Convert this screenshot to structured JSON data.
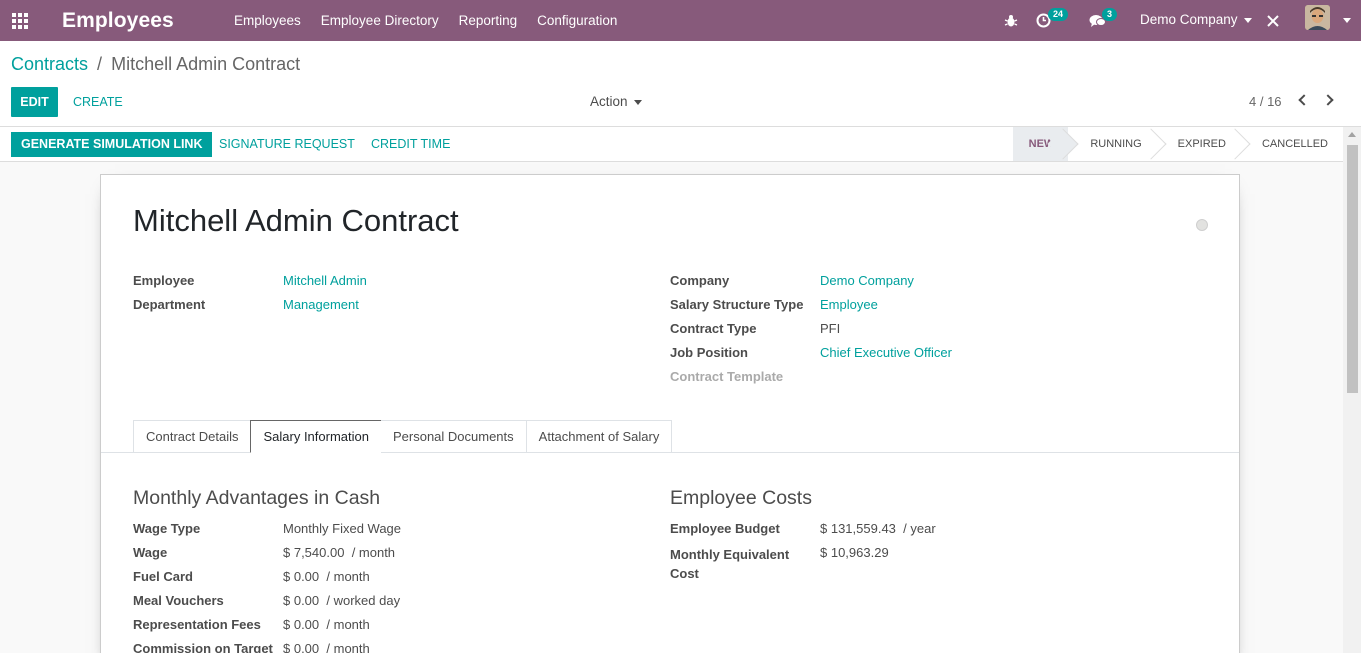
{
  "navbar": {
    "brand": "Employees",
    "menu": [
      "Employees",
      "Employee Directory",
      "Reporting",
      "Configuration"
    ],
    "activity_count": "24",
    "message_count": "3",
    "company": "Demo Company"
  },
  "breadcrumb": {
    "parent": "Contracts",
    "separator": "/",
    "current": "Mitchell Admin Contract"
  },
  "buttons": {
    "edit": "EDIT",
    "create": "CREATE",
    "action": "Action",
    "pager": "4 / 16"
  },
  "statusbar": {
    "generate": "GENERATE SIMULATION LINK",
    "signature": "SIGNATURE REQUEST",
    "credit_time": "CREDIT TIME",
    "stages": [
      "NEW",
      "RUNNING",
      "EXPIRED",
      "CANCELLED"
    ],
    "current_stage": "NEW"
  },
  "form": {
    "title": "Mitchell Admin Contract",
    "left": [
      {
        "label": "Employee",
        "value": "Mitchell Admin"
      },
      {
        "label": "Department",
        "value": "Management"
      }
    ],
    "right": [
      {
        "label": "Company",
        "value": "Demo Company"
      },
      {
        "label": "Salary Structure Type",
        "value": "Employee"
      },
      {
        "label": "Contract Type",
        "value": "PFI"
      },
      {
        "label": "Job Position",
        "value": "Chief Executive Officer"
      },
      {
        "label": "Contract Template",
        "value": ""
      }
    ],
    "tabs": [
      "Contract Details",
      "Salary Information",
      "Personal Documents",
      "Attachment of Salary"
    ],
    "active_tab": "Salary Information"
  },
  "salary": {
    "left_title": "Monthly Advantages in Cash",
    "left_rows": [
      {
        "label": "Wage Type",
        "value": "Monthly Fixed Wage",
        "unit": ""
      },
      {
        "label": "Wage",
        "value": "$ 7,540.00",
        "unit": "/ month"
      },
      {
        "label": "Fuel Card",
        "value": "$ 0.00",
        "unit": "/ month"
      },
      {
        "label": "Meal Vouchers",
        "value": "$ 0.00",
        "unit": "/ worked day"
      },
      {
        "label": "Representation Fees",
        "value": "$ 0.00",
        "unit": "/ month"
      },
      {
        "label": "Commission on Target",
        "value": "$ 0.00",
        "unit": "/ month"
      }
    ],
    "right_title": "Employee Costs",
    "budget_label": "Employee Budget",
    "budget_value": "$ 131,559.43",
    "budget_unit": "/ year",
    "monthly_label_1": "Monthly Equivalent",
    "monthly_label_2": "Cost",
    "monthly_value": "$ 10,963.29"
  }
}
